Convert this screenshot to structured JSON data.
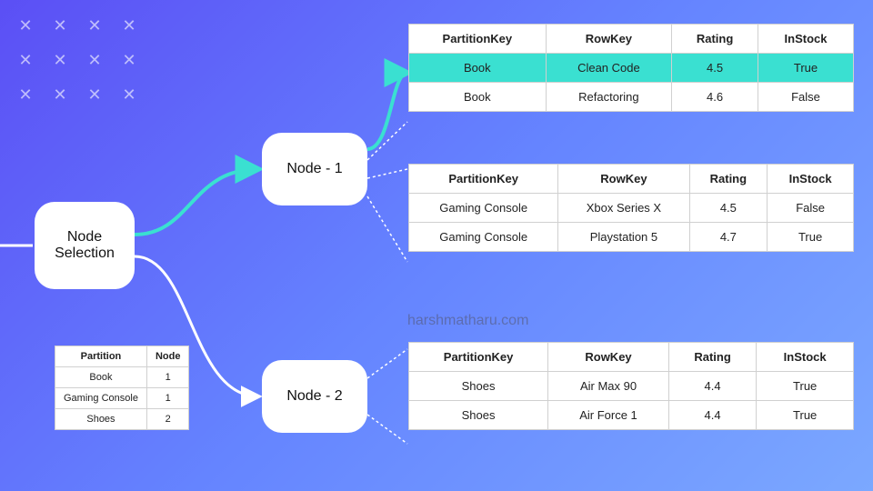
{
  "decor": {
    "x": "✕"
  },
  "watermark": "harshmatharu.com",
  "boxes": {
    "selection": "Node Selection",
    "node1": "Node - 1",
    "node2": "Node - 2"
  },
  "partitionTable": {
    "headers": {
      "partition": "Partition",
      "node": "Node"
    },
    "rows": [
      {
        "partition": "Book",
        "node": "1"
      },
      {
        "partition": "Gaming Console",
        "node": "1"
      },
      {
        "partition": "Shoes",
        "node": "2"
      }
    ]
  },
  "dataTables": {
    "headers": {
      "pk": "PartitionKey",
      "rk": "RowKey",
      "rating": "Rating",
      "instock": "InStock"
    },
    "book": {
      "rows": [
        {
          "pk": "Book",
          "rk": "Clean Code",
          "rating": "4.5",
          "instock": "True",
          "highlight": true
        },
        {
          "pk": "Book",
          "rk": "Refactoring",
          "rating": "4.6",
          "instock": "False"
        }
      ]
    },
    "console": {
      "rows": [
        {
          "pk": "Gaming Console",
          "rk": "Xbox Series X",
          "rating": "4.5",
          "instock": "False"
        },
        {
          "pk": "Gaming Console",
          "rk": "Playstation 5",
          "rating": "4.7",
          "instock": "True"
        }
      ]
    },
    "shoes": {
      "rows": [
        {
          "pk": "Shoes",
          "rk": "Air Max 90",
          "rating": "4.4",
          "instock": "True"
        },
        {
          "pk": "Shoes",
          "rk": "Air Force 1",
          "rating": "4.4",
          "instock": "True"
        }
      ]
    }
  }
}
